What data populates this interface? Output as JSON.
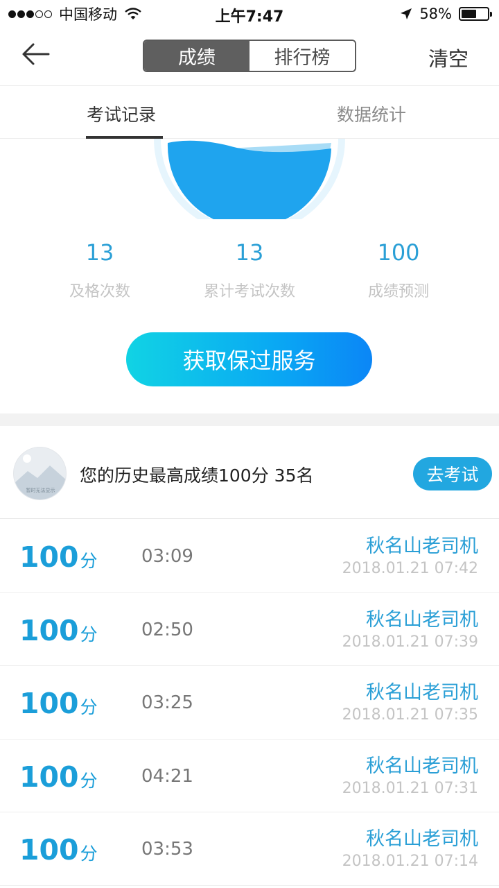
{
  "status_bar": {
    "carrier": "中国移动",
    "time": "上午7:47",
    "battery": "58%",
    "battery_level": 0.58,
    "signal_dots": [
      true,
      true,
      true,
      false,
      false
    ]
  },
  "nav": {
    "segments": [
      "成绩",
      "排行榜"
    ],
    "active_segment": 0,
    "clear_label": "清空"
  },
  "tabs": {
    "items": [
      "考试记录",
      "数据统计"
    ],
    "active": 0
  },
  "stats": [
    {
      "value": "13",
      "label": "及格次数"
    },
    {
      "value": "13",
      "label": "累计考试次数"
    },
    {
      "value": "100",
      "label": "成绩预测"
    }
  ],
  "cta_label": "获取保过服务",
  "best": {
    "text": "您的历史最高成绩100分  35名",
    "button": "去考试",
    "avatar_caption": "暂时无法显示"
  },
  "records": [
    {
      "score": "100",
      "unit": "分",
      "duration": "03:09",
      "user": "秋名山老司机",
      "time": "2018.01.21 07:42"
    },
    {
      "score": "100",
      "unit": "分",
      "duration": "02:50",
      "user": "秋名山老司机",
      "time": "2018.01.21 07:39"
    },
    {
      "score": "100",
      "unit": "分",
      "duration": "03:25",
      "user": "秋名山老司机",
      "time": "2018.01.21 07:35"
    },
    {
      "score": "100",
      "unit": "分",
      "duration": "04:21",
      "user": "秋名山老司机",
      "time": "2018.01.21 07:31"
    },
    {
      "score": "100",
      "unit": "分",
      "duration": "03:53",
      "user": "秋名山老司机",
      "time": "2018.01.21 07:14"
    }
  ],
  "colors": {
    "accent": "#2a9fd6",
    "gauge_fill": "#1fa4ee",
    "gauge_ring": "#e6f5fd"
  }
}
